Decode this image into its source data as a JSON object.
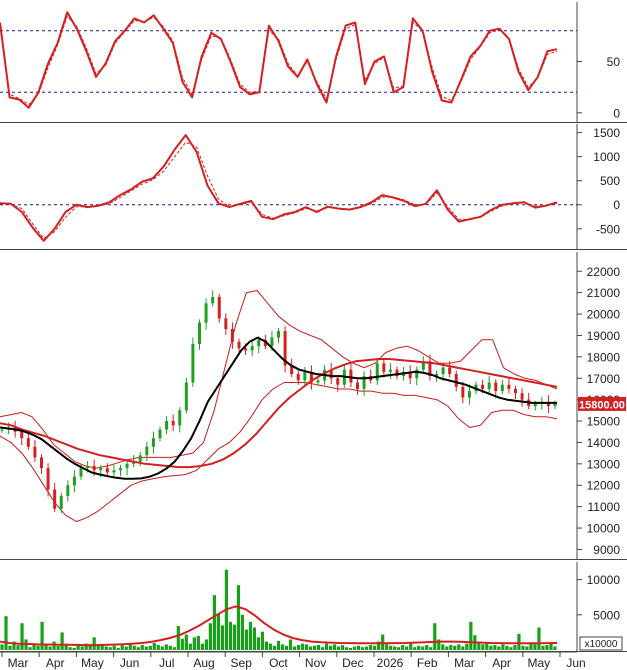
{
  "chart_data": {
    "type": "stock-chart",
    "x_months": [
      "Mar",
      "Apr",
      "May",
      "Jun",
      "Jul",
      "Aug",
      "Sep",
      "Oct",
      "Nov",
      "Dec",
      "2026",
      "Feb",
      "Mar",
      "Apr",
      "May",
      "Jun"
    ],
    "colors": {
      "up": "#1fa01f",
      "down": "#d42020",
      "ma_slow": "#d42020",
      "ma_fast": "#000000",
      "band": "#c81e1e",
      "ref_line": "#1a1aa0",
      "price_tag": "#d42020",
      "volume": "#18a018"
    },
    "panels": [
      {
        "id": "oscillator",
        "ylim": [
          -8,
          108
        ],
        "yticks": [
          {
            "v": 0,
            "label": "0"
          },
          {
            "v": 50,
            "label": "50"
          }
        ],
        "ref_lines": [
          20,
          80
        ],
        "series": [
          {
            "values": [
              88,
              15,
              13,
              5,
              20,
              48,
              68,
              98,
              82,
              60,
              35,
              48,
              70,
              80,
              92,
              88,
              95,
              82,
              68,
              30,
              15,
              55,
              78,
              72,
              50,
              25,
              18,
              20,
              85,
              70,
              45,
              35,
              52,
              28,
              10,
              55,
              85,
              88,
              28,
              50,
              55,
              20,
              25,
              92,
              80,
              40,
              12,
              10,
              32,
              55,
              65,
              80,
              82,
              72,
              40,
              22,
              35,
              60,
              62
            ],
            "smooth": [
              84,
              18,
              14,
              8,
              18,
              44,
              66,
              94,
              84,
              63,
              38,
              46,
              68,
              79,
              90,
              89,
              93,
              84,
              70,
              34,
              18,
              52,
              75,
              73,
              52,
              28,
              20,
              21,
              80,
              72,
              48,
              36,
              50,
              30,
              14,
              52,
              82,
              86,
              32,
              48,
              54,
              24,
              26,
              88,
              80,
              44,
              16,
              12,
              30,
              52,
              64,
              78,
              81,
              73,
              43,
              25,
              34,
              57,
              60
            ]
          }
        ]
      },
      {
        "id": "macd",
        "ylim": [
          -900,
          1680
        ],
        "yticks": [
          {
            "v": -500,
            "label": "-500"
          },
          {
            "v": 0,
            "label": "0"
          },
          {
            "v": 500,
            "label": "500"
          },
          {
            "v": 1000,
            "label": "1000"
          },
          {
            "v": 1500,
            "label": "1500"
          }
        ],
        "ref_lines": [
          0
        ],
        "series": [
          {
            "values": [
              30,
              20,
              -150,
              -480,
              -750,
              -500,
              -150,
              0,
              -50,
              -20,
              50,
              200,
              320,
              480,
              550,
              800,
              1150,
              1450,
              1100,
              400,
              30,
              -50,
              20,
              80,
              -250,
              -300,
              -200,
              -150,
              -50,
              -150,
              -40,
              -80,
              -100,
              -50,
              50,
              200,
              150,
              80,
              -30,
              20,
              300,
              -100,
              -350,
              -300,
              -250,
              -100,
              0,
              30,
              50,
              -60,
              -20,
              50
            ],
            "smooth": [
              20,
              10,
              -80,
              -400,
              -700,
              -560,
              -260,
              -40,
              -40,
              -30,
              20,
              150,
              290,
              430,
              520,
              700,
              1000,
              1300,
              1200,
              600,
              120,
              -40,
              0,
              60,
              -200,
              -280,
              -230,
              -170,
              -80,
              -130,
              -60,
              -70,
              -90,
              -60,
              20,
              160,
              160,
              100,
              0,
              10,
              250,
              -40,
              -300,
              -310,
              -260,
              -130,
              -20,
              20,
              40,
              -30,
              -20,
              30
            ]
          }
        ]
      },
      {
        "id": "price",
        "ylim": [
          8600,
          22900
        ],
        "yticks": [
          {
            "v": 9000,
            "label": "9000"
          },
          {
            "v": 10000,
            "label": "10000"
          },
          {
            "v": 11000,
            "label": "11000"
          },
          {
            "v": 12000,
            "label": "12000"
          },
          {
            "v": 13000,
            "label": "13000"
          },
          {
            "v": 14000,
            "label": "14000"
          },
          {
            "v": 15000,
            "label": "15000"
          },
          {
            "v": 16000,
            "label": "16000"
          },
          {
            "v": 17000,
            "label": "17000"
          },
          {
            "v": 18000,
            "label": "18000"
          },
          {
            "v": 19000,
            "label": "19000"
          },
          {
            "v": 20000,
            "label": "20000"
          },
          {
            "v": 21000,
            "label": "21000"
          },
          {
            "v": 22000,
            "label": "22000"
          }
        ],
        "last_price": "15800.00",
        "close": [
          14600,
          14700,
          14500,
          14200,
          13800,
          13300,
          12800,
          11800,
          10900,
          11500,
          12000,
          12400,
          12800,
          12900,
          12700,
          12800,
          12600,
          12700,
          12800,
          13000,
          13100,
          13400,
          13800,
          14200,
          14600,
          15000,
          14800,
          15500,
          16800,
          18600,
          19600,
          20500,
          20800,
          19800,
          19300,
          18700,
          18400,
          18300,
          18500,
          18800,
          18500,
          18900,
          19200,
          17600,
          17200,
          16900,
          17300,
          16800,
          16900,
          17400,
          17000,
          16700,
          17400,
          16800,
          16500,
          17100,
          16900,
          17700,
          17300,
          17400,
          17100,
          17300,
          17000,
          17400,
          17800,
          17100,
          17200,
          17500,
          17200,
          16600,
          16100,
          16400,
          16700,
          16500,
          16800,
          16400,
          16700,
          16500,
          16300,
          16000,
          15700,
          15800,
          15900,
          15700,
          15800
        ],
        "ma_fast": [
          14700,
          14650,
          14600,
          14500,
          14350,
          14150,
          13850,
          13550,
          13250,
          13000,
          12800,
          12600,
          12500,
          12420,
          12350,
          12300,
          12300,
          12320,
          12400,
          12550,
          12780,
          13100,
          13600,
          14200,
          15000,
          15900,
          16500,
          17100,
          17700,
          18300,
          18700,
          18900,
          18700,
          18300,
          17900,
          17600,
          17400,
          17300,
          17200,
          17150,
          17100,
          17100,
          17050,
          17000,
          17000,
          17050,
          17100,
          17150,
          17200,
          17250,
          17300,
          17250,
          17150,
          17000,
          16900,
          16800,
          16700,
          16550,
          16400,
          16250,
          16100,
          16000,
          15950,
          15900,
          15850,
          15850,
          15850,
          15850
        ],
        "ma_slow": [
          14900,
          14800,
          14600,
          14450,
          14300,
          14100,
          13900,
          13700,
          13550,
          13400,
          13300,
          13200,
          13100,
          13000,
          12950,
          12900,
          12850,
          12850,
          12900,
          13000,
          13200,
          13500,
          13900,
          14400,
          15000,
          15600,
          16100,
          16500,
          16900,
          17200,
          17450,
          17650,
          17800,
          17850,
          17900,
          17900,
          17850,
          17800,
          17750,
          17700,
          17600,
          17500,
          17400,
          17300,
          17200,
          17100,
          17000,
          16900,
          16800,
          16700,
          16600
        ],
        "band_upper": [
          15200,
          15300,
          15400,
          15200,
          14600,
          13900,
          13500,
          13100,
          12900,
          12800,
          12900,
          13050,
          13200,
          13300,
          13300,
          13300,
          13300,
          13400,
          13500,
          14000,
          15500,
          17500,
          19500,
          21000,
          21100,
          20500,
          19900,
          19500,
          19200,
          19000,
          18800,
          18400,
          18000,
          17700,
          17500,
          17700,
          18200,
          18400,
          18500,
          18300,
          18000,
          17700,
          17700,
          17800,
          18300,
          18800,
          18800,
          17500,
          17200,
          17000,
          16900,
          16700,
          16500
        ],
        "band_lower": [
          14300,
          14000,
          13500,
          12800,
          12000,
          11200,
          10600,
          10300,
          10500,
          10800,
          11200,
          11600,
          12000,
          12200,
          12300,
          12400,
          12450,
          12500,
          12700,
          13200,
          13700,
          14000,
          14500,
          15200,
          16000,
          16500,
          16800,
          16800,
          16800,
          16700,
          16600,
          16500,
          16500,
          16400,
          16400,
          16300,
          16300,
          16200,
          16200,
          16100,
          16000,
          15700,
          15100,
          14700,
          14800,
          15400,
          15500,
          15500,
          15300,
          15200,
          15200,
          15100
        ]
      },
      {
        "id": "volume",
        "ylim": [
          0,
          12500
        ],
        "yticks": [
          {
            "v": 5000,
            "label": "5000"
          },
          {
            "v": 10000,
            "label": "10000"
          }
        ],
        "unit": "x10000",
        "bars": [
          800,
          4800,
          600,
          1200,
          700,
          3800,
          1500,
          400,
          900,
          600,
          4000,
          700,
          500,
          1200,
          600,
          2500,
          900,
          400,
          300,
          700,
          500,
          900,
          600,
          1800,
          700,
          800,
          500,
          400,
          600,
          300,
          700,
          500,
          900,
          600,
          400,
          700,
          500,
          600,
          1000,
          700,
          500,
          800,
          600,
          400,
          3400,
          1600,
          2200,
          900,
          1800,
          2000,
          900,
          1500,
          3800,
          7800,
          5200,
          3500,
          11400,
          4000,
          3600,
          9200,
          5000,
          2900,
          4000,
          3200,
          1800,
          2600,
          1200,
          900,
          600,
          1300,
          800,
          600,
          1500,
          500,
          700,
          900,
          800,
          500,
          600,
          700,
          400,
          900,
          600,
          800,
          500,
          700,
          400,
          300,
          500,
          600,
          400,
          500,
          700,
          600,
          1200,
          2200,
          800,
          600,
          500,
          400,
          700,
          500,
          900,
          400,
          600,
          500,
          700,
          400,
          3800,
          1500,
          800,
          500,
          700,
          600,
          800,
          500,
          900,
          4000,
          2100,
          1200,
          800,
          900,
          600,
          700,
          500,
          800,
          600,
          400,
          700,
          2300,
          600,
          500,
          900,
          800,
          3200,
          600,
          700,
          1000,
          500
        ],
        "ma": [
          1200,
          1000,
          900,
          850,
          800,
          780,
          760,
          740,
          720,
          700,
          700,
          720,
          760,
          820,
          900,
          1000,
          1150,
          1400,
          1700,
          2100,
          2700,
          3400,
          4200,
          5000,
          5800,
          6200,
          5800,
          4900,
          3800,
          2900,
          2200,
          1700,
          1400,
          1200,
          1100,
          1050,
          1000,
          980,
          960,
          950,
          950,
          950,
          980,
          1000,
          1050,
          1100,
          1150,
          1200,
          1200,
          1150,
          1100,
          1050,
          1000,
          980,
          960,
          950,
          950,
          960,
          980,
          1000
        ]
      }
    ]
  }
}
